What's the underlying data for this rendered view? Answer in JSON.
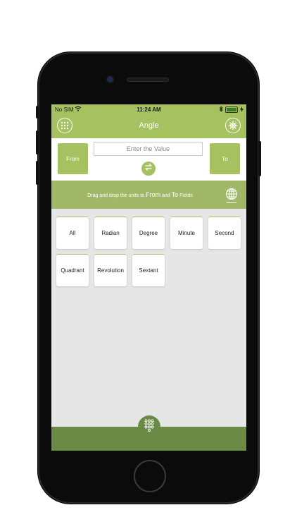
{
  "status_bar": {
    "carrier": "No SIM",
    "time": "11:24 AM"
  },
  "nav": {
    "title": "Angle",
    "left_icon": "grid-menu-icon",
    "right_icon": "gear-icon"
  },
  "converter": {
    "from_label": "From",
    "to_label": "To",
    "input_placeholder": "Enter the Value",
    "swap_icon": "swap-arrows-icon"
  },
  "hint": {
    "part1": "Drag and drop the units to ",
    "from_word": "From",
    "part2": " and ",
    "to_word": "To",
    "part3": " Fields",
    "globe_icon": "globe-icon"
  },
  "units": [
    "All",
    "Radian",
    "Degree",
    "Minute",
    "Second",
    "Quadrant",
    "Revolution",
    "Sextant"
  ],
  "colors": {
    "accent": "#a6c160",
    "hint_bar": "#a1b868",
    "bottom_bar": "#6b8a45"
  },
  "bottom": {
    "keypad_icon": "keypad-icon"
  }
}
